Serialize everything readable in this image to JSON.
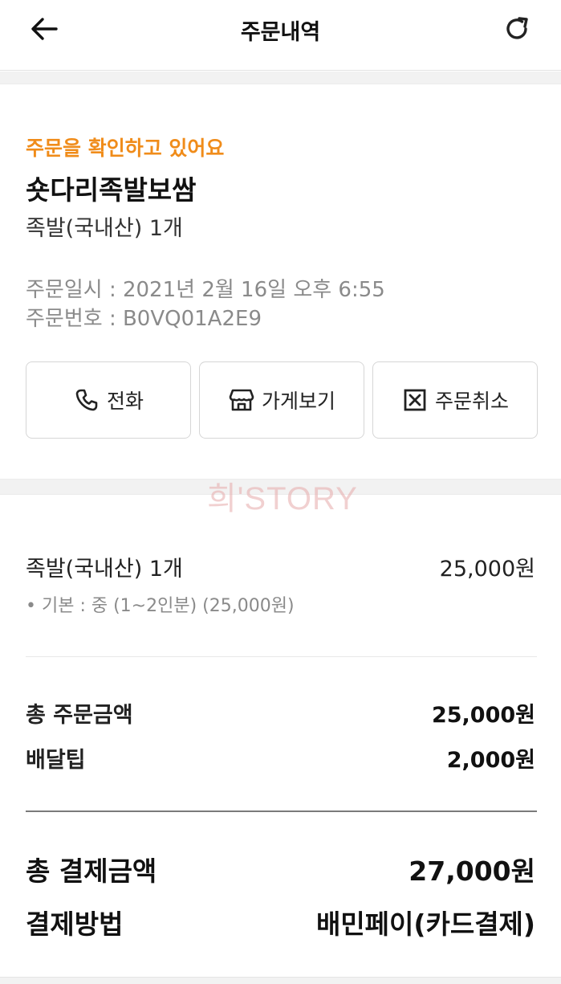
{
  "header": {
    "title": "주문내역",
    "back_icon": "arrow-left-icon",
    "refresh_icon": "refresh-icon"
  },
  "order": {
    "status": "주문을 확인하고 있어요",
    "status_color": "#f08c1a",
    "store_name": "숏다리족발보쌈",
    "menu_summary": "족발(국내산) 1개",
    "date_line": "주문일시 : 2021년 2월 16일 오후 6:55",
    "number_line": "주문번호 : B0VQ01A2E9"
  },
  "actions": {
    "call_label": "전화",
    "call_icon": "phone-icon",
    "store_label": "가게보기",
    "store_icon": "store-icon",
    "cancel_label": "주문취소",
    "cancel_icon": "close-box-icon"
  },
  "watermark": "희'STORY",
  "item": {
    "name": "족발(국내산) 1개",
    "price": "25,000원",
    "option": "• 기본 : 중 (1~2인분) (25,000원)"
  },
  "summary": {
    "order_total_label": "총 주문금액",
    "order_total_value": "25,000원",
    "delivery_tip_label": "배달팁",
    "delivery_tip_value": "2,000원"
  },
  "payment": {
    "total_label": "총 결제금액",
    "total_value": "27,000원",
    "method_label": "결제방법",
    "method_value": "배민페이(카드결제)"
  }
}
